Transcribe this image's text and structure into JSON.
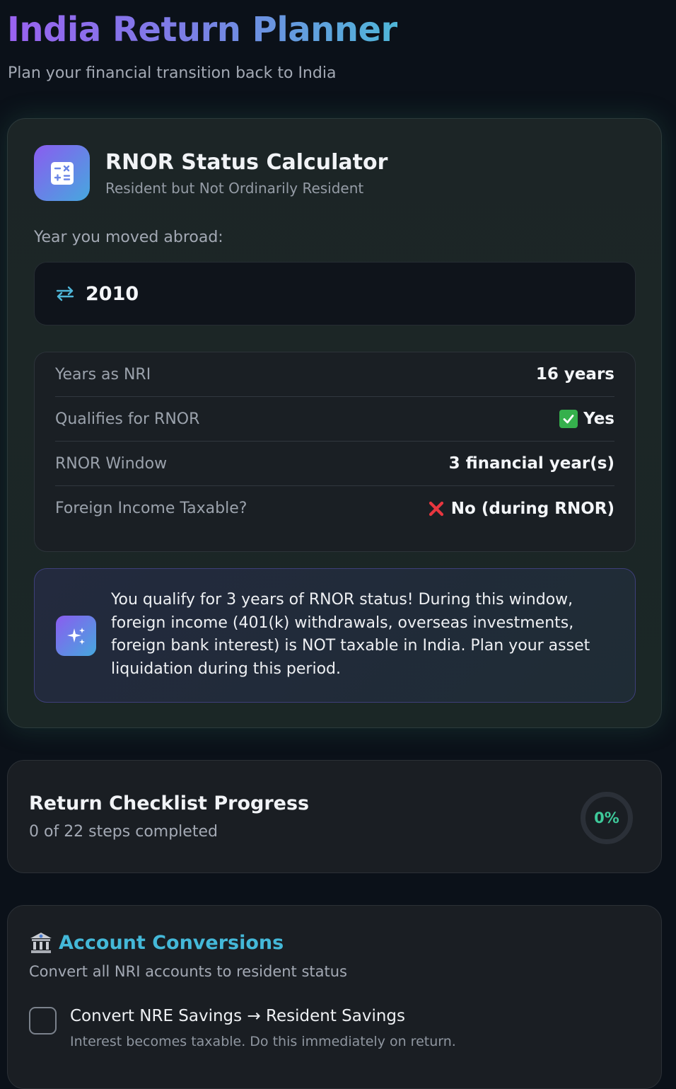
{
  "header": {
    "title": "India Return Planner",
    "subtitle": "Plan your financial transition back to India"
  },
  "rnor": {
    "icon": "calculator-icon",
    "title": "RNOR Status Calculator",
    "subtitle": "Resident but Not Ordinarily Resident",
    "field_label": "Year you moved abroad:",
    "year_value": "2010",
    "stats": [
      {
        "label": "Years as NRI",
        "value": "16 years"
      },
      {
        "label": "Qualifies for RNOR",
        "value": "Yes"
      },
      {
        "label": "RNOR Window",
        "value": "3 financial year(s)"
      },
      {
        "label": "Foreign Income Taxable?",
        "value": "No (during RNOR)"
      }
    ],
    "tip_icon": "sparkles-icon",
    "tip": "You qualify for 3 years of RNOR status! During this window, foreign income (401(k) withdrawals, overseas investments, foreign bank interest) is NOT taxable in India. Plan your asset liquidation during this period."
  },
  "progress": {
    "title": "Return Checklist Progress",
    "subtitle": "0 of 22 steps completed",
    "percent_label": "0%",
    "percent": 0
  },
  "accounts": {
    "icon": "bank-icon",
    "title": "Account Conversions",
    "subtitle": "Convert all NRI accounts to resident status",
    "items": [
      {
        "title": "Convert NRE Savings → Resident Savings",
        "description": "Interest becomes taxable. Do this immediately on return.",
        "checked": false
      }
    ]
  },
  "colors": {
    "accent_purple": "#8a5cf0",
    "accent_cyan": "#46a8de",
    "success_green": "#3ec99a",
    "background": "#0b1119"
  }
}
